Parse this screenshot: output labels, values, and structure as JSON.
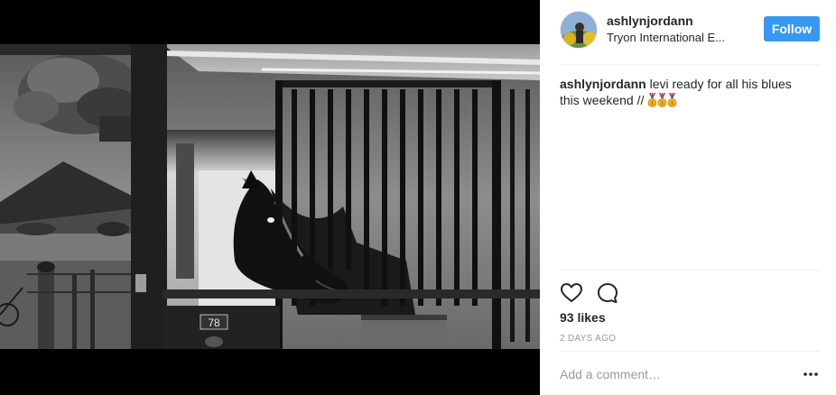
{
  "post": {
    "photo_alt": "black and white photo of a horse looking out from a stable stall",
    "stall_number": "78"
  },
  "header": {
    "username": "ashlynjordann",
    "location": "Tryon International E...",
    "follow_label": "Follow"
  },
  "caption": {
    "username": "ashlynjordann",
    "text": "levi ready for all his blues this weekend // ",
    "medal_emoji": [
      "gold-medal",
      "gold-medal",
      "gold-medal"
    ]
  },
  "actions": {
    "like_icon": "heart-icon",
    "comment_icon": "comment-icon"
  },
  "likes": "93 likes",
  "timestamp": "2 DAYS AGO",
  "comment_box": {
    "placeholder": "Add a comment…"
  },
  "more_icon": "more-options-icon",
  "colors": {
    "follow_button": "#3897f0",
    "text": "#262626",
    "muted": "#999999",
    "divider": "#efefef"
  }
}
